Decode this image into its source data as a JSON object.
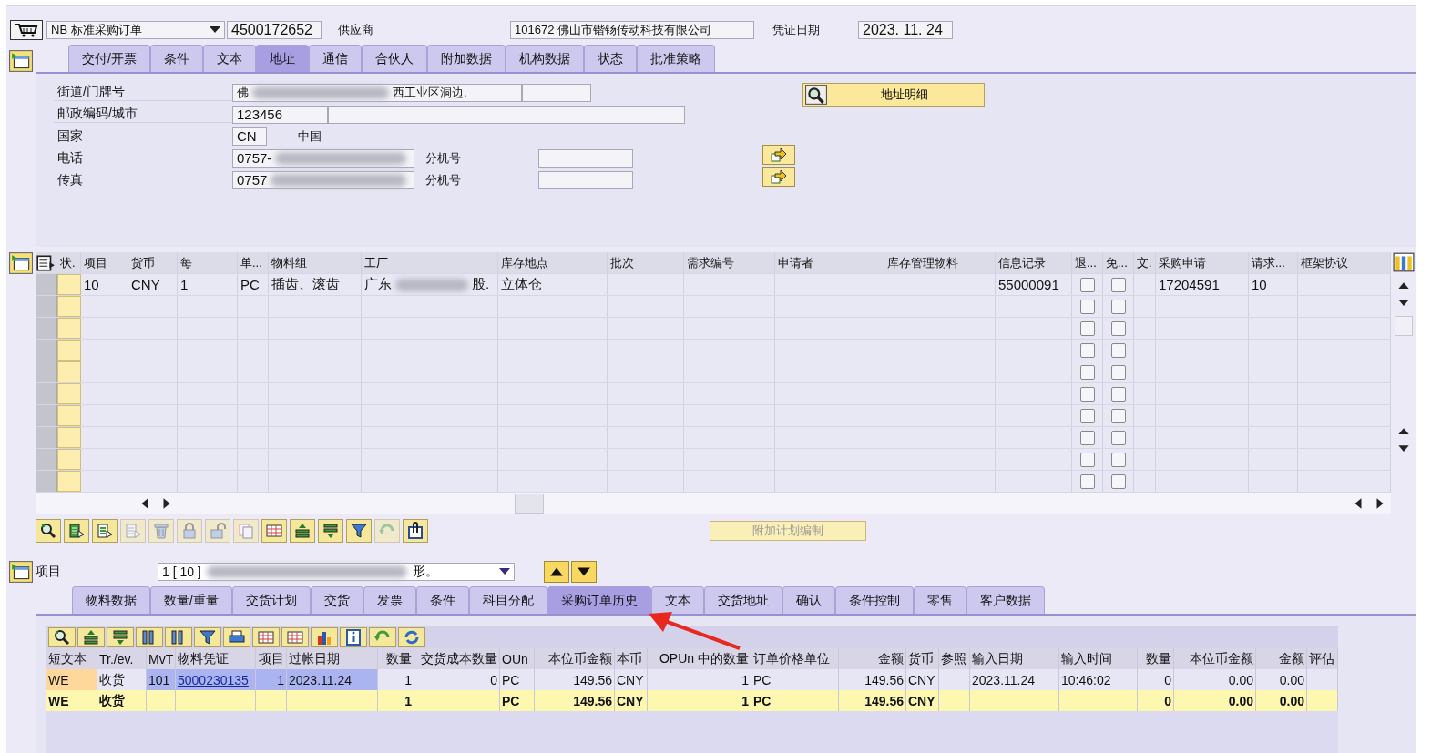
{
  "header": {
    "doc_type": "NB 标准采购订单",
    "po_number": "4500172652",
    "vendor_label": "供应商",
    "vendor_code": "101672",
    "vendor_name": "佛山市锴钖传动科技有限公司",
    "date_label": "凭证日期",
    "date": "2023. 11. 24"
  },
  "header_tabs": [
    {
      "label": "交付/开票",
      "selected": false
    },
    {
      "label": "条件",
      "selected": false
    },
    {
      "label": "文本",
      "selected": false
    },
    {
      "label": "地址",
      "selected": true
    },
    {
      "label": "通信",
      "selected": false
    },
    {
      "label": "合伙人",
      "selected": false
    },
    {
      "label": "附加数据",
      "selected": false
    },
    {
      "label": "机构数据",
      "selected": false
    },
    {
      "label": "状态",
      "selected": false
    },
    {
      "label": "批准策略",
      "selected": false
    }
  ],
  "address": {
    "street": {
      "label": "街道/门牌号",
      "parts": [
        "佛",
        "西工业区洞边."
      ]
    },
    "postal": {
      "label": "邮政编码/城市",
      "value": "123456"
    },
    "country": {
      "label": "国家",
      "code": "CN",
      "name": "中国"
    },
    "phones": [
      {
        "label": "电话",
        "value": "0757-",
        "ext_label": "分机号"
      },
      {
        "label": "传真",
        "value": "0757",
        "ext_label": "分机号"
      }
    ],
    "detail_button": "地址明细"
  },
  "items": {
    "columns": [
      {
        "label": "状.",
        "kind": "status"
      },
      {
        "label": "项目",
        "kind": "text"
      },
      {
        "label": "货币",
        "kind": "text"
      },
      {
        "label": "每",
        "kind": "text"
      },
      {
        "label": "单...",
        "kind": "text"
      },
      {
        "label": "物料组",
        "kind": "text"
      },
      {
        "label": "工厂",
        "kind": "text"
      },
      {
        "label": "库存地点",
        "kind": "text"
      },
      {
        "label": "批次",
        "kind": "text"
      },
      {
        "label": "需求编号",
        "kind": "text"
      },
      {
        "label": "申请者",
        "kind": "text"
      },
      {
        "label": "库存管理物料",
        "kind": "text"
      },
      {
        "label": "信息记录",
        "kind": "text"
      },
      {
        "label": "退...",
        "kind": "check"
      },
      {
        "label": "免...",
        "kind": "check"
      },
      {
        "label": "文.",
        "kind": "text"
      },
      {
        "label": "采购申请",
        "kind": "text"
      },
      {
        "label": "请求...",
        "kind": "text"
      },
      {
        "label": "框架协议",
        "kind": "text"
      }
    ],
    "rows": [
      {
        "cells": [
          null,
          "10",
          "CNY",
          "1",
          "PC",
          "插齿、滚齿",
          [
            "广东",
            "股."
          ],
          "立体仓",
          null,
          null,
          null,
          null,
          "55000091",
          false,
          false,
          null,
          "17204591",
          "10",
          null
        ]
      },
      {
        "cells": [
          null,
          null,
          null,
          null,
          null,
          null,
          null,
          null,
          null,
          null,
          null,
          null,
          null,
          false,
          false,
          null,
          null,
          null,
          null
        ]
      },
      {
        "cells": [
          null,
          null,
          null,
          null,
          null,
          null,
          null,
          null,
          null,
          null,
          null,
          null,
          null,
          false,
          false,
          null,
          null,
          null,
          null
        ]
      },
      {
        "cells": [
          null,
          null,
          null,
          null,
          null,
          null,
          null,
          null,
          null,
          null,
          null,
          null,
          null,
          false,
          false,
          null,
          null,
          null,
          null
        ]
      },
      {
        "cells": [
          null,
          null,
          null,
          null,
          null,
          null,
          null,
          null,
          null,
          null,
          null,
          null,
          null,
          false,
          false,
          null,
          null,
          null,
          null
        ]
      },
      {
        "cells": [
          null,
          null,
          null,
          null,
          null,
          null,
          null,
          null,
          null,
          null,
          null,
          null,
          null,
          false,
          false,
          null,
          null,
          null,
          null
        ]
      },
      {
        "cells": [
          null,
          null,
          null,
          null,
          null,
          null,
          null,
          null,
          null,
          null,
          null,
          null,
          null,
          false,
          false,
          null,
          null,
          null,
          null
        ]
      },
      {
        "cells": [
          null,
          null,
          null,
          null,
          null,
          null,
          null,
          null,
          null,
          null,
          null,
          null,
          null,
          false,
          false,
          null,
          null,
          null,
          null
        ]
      },
      {
        "cells": [
          null,
          null,
          null,
          null,
          null,
          null,
          null,
          null,
          null,
          null,
          null,
          null,
          null,
          false,
          false,
          null,
          null,
          null,
          null
        ]
      },
      {
        "cells": [
          null,
          null,
          null,
          null,
          null,
          null,
          null,
          null,
          null,
          null,
          null,
          null,
          null,
          false,
          false,
          null,
          null,
          null,
          null
        ]
      }
    ]
  },
  "item_toolbar": [
    {
      "kind": "detail",
      "disabled": false
    },
    {
      "kind": "select-all",
      "disabled": false
    },
    {
      "kind": "select-block",
      "disabled": false
    },
    {
      "kind": "deselect",
      "disabled": true
    },
    {
      "kind": "delete",
      "disabled": true
    },
    {
      "kind": "lock",
      "disabled": true
    },
    {
      "kind": "unlock",
      "disabled": true
    },
    {
      "kind": "copy",
      "disabled": true
    },
    {
      "kind": "grid",
      "disabled": false
    },
    {
      "kind": "sort-up",
      "disabled": false
    },
    {
      "kind": "sort-down",
      "disabled": false
    },
    {
      "kind": "filter",
      "disabled": false
    },
    {
      "kind": "undo",
      "disabled": true
    },
    {
      "kind": "attach",
      "disabled": false
    }
  ],
  "schedule_button": {
    "label": "附加计划编制",
    "disabled": true
  },
  "item_selector": {
    "label": "项目",
    "value": "1 [ 10 ]",
    "tail": "形。"
  },
  "item_tabs": [
    {
      "label": "物料数据",
      "selected": false
    },
    {
      "label": "数量/重量",
      "selected": false
    },
    {
      "label": "交货计划",
      "selected": false
    },
    {
      "label": "交货",
      "selected": false
    },
    {
      "label": "发票",
      "selected": false
    },
    {
      "label": "条件",
      "selected": false
    },
    {
      "label": "科目分配",
      "selected": false
    },
    {
      "label": "采购订单历史",
      "selected": true
    },
    {
      "label": "文本",
      "selected": false
    },
    {
      "label": "交货地址",
      "selected": false
    },
    {
      "label": "确认",
      "selected": false
    },
    {
      "label": "条件控制",
      "selected": false
    },
    {
      "label": "零售",
      "selected": false
    },
    {
      "label": "客户数据",
      "selected": false
    }
  ],
  "history_toolbar": [
    {
      "kind": "detail"
    },
    {
      "kind": "sort-up"
    },
    {
      "kind": "sort-down"
    },
    {
      "kind": "columns"
    },
    {
      "kind": "columns"
    },
    {
      "kind": "filter"
    },
    {
      "kind": "print"
    },
    {
      "kind": "grid"
    },
    {
      "kind": "grid"
    },
    {
      "kind": "chart"
    },
    {
      "kind": "info"
    },
    {
      "kind": "undo"
    },
    {
      "kind": "refresh"
    }
  ],
  "history": {
    "columns": [
      "短文本",
      "Tr./ev.",
      "MvT",
      "物料凭证",
      "项目",
      "过帐日期",
      "数量",
      "交货成本数量",
      "OUn",
      "本位币金额",
      "本币",
      "OPUn 中的数量",
      "订单价格单位",
      "金额",
      "货币",
      "参照",
      "输入日期",
      "输入时间",
      "数量",
      "本位币金额",
      "金额",
      "评估"
    ],
    "rows": [
      {
        "kind": "detail",
        "cells": [
          "WE",
          "收货",
          "101",
          "5000230135",
          "1",
          "2023.11.24",
          "1",
          "0",
          "PC",
          "149.56",
          "CNY",
          "1",
          "PC",
          "149.56",
          "CNY",
          null,
          "2023.11.24",
          "10:46:02",
          "0",
          "0.00",
          "0.00",
          null
        ]
      },
      {
        "kind": "total",
        "cells": [
          "WE",
          "收货",
          null,
          null,
          null,
          null,
          "1",
          null,
          "PC",
          "149.56",
          "CNY",
          "1",
          "PC",
          "149.56",
          "CNY",
          null,
          null,
          null,
          "0",
          "0.00",
          "0.00",
          null
        ]
      }
    ]
  }
}
